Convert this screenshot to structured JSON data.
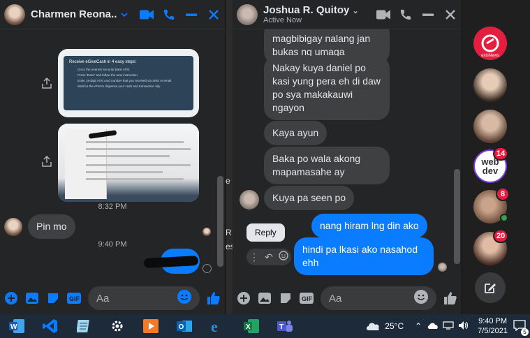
{
  "left_chat": {
    "name": "Charmen Reona...",
    "time_1": "8:32 PM",
    "msg_pin": "Pin mo",
    "time_2": "9:40 PM",
    "composer_placeholder": "Aa",
    "card_title": "Receive eGiveCash in 4 easy steps:",
    "card_steps": [
      "Go to the nearest Security Bank ATM.",
      "Press 'Enter' and follow the next instruction.",
      "Enter 16-digit ATM card number that you received via SMS or email.",
      "Wait for the ATM to dispense your cash and transaction slip."
    ]
  },
  "mid_chat": {
    "name": "Joshua R. Quitoy",
    "status": "Active Now",
    "messages": [
      {
        "text": "magbibigay nalang jan bukas ng umaga",
        "from": "them"
      },
      {
        "text": "Nakay kuya daniel po kasi yung pera eh di daw po sya makakauwi ngayon",
        "from": "them"
      },
      {
        "text": "Kaya ayun",
        "from": "them"
      },
      {
        "text": "Baka po wala akong mapamasahe ay",
        "from": "them"
      },
      {
        "text": "Kuya pa seen po",
        "from": "them"
      },
      {
        "text": "nang hiram lng din ako",
        "from": "me"
      },
      {
        "text": "hindi pa lkasi ako nasahod ehh",
        "from": "me"
      }
    ],
    "reply_label": "Reply",
    "composer_placeholder": "Aa"
  },
  "edge_letters": [
    "e",
    "R",
    "es"
  ],
  "dock": {
    "badges": [
      "14",
      "8",
      "20"
    ],
    "webdev_label_1": "web",
    "webdev_label_2": "dev",
    "news_label": "exisNews"
  },
  "taskbar": {
    "temperature": "25°C",
    "time": "9:40 PM",
    "date": "7/5/2021",
    "notification_count": "5"
  },
  "colors": {
    "accent": "#0a7cff",
    "bubble_them": "#3e4042",
    "bg": "#242526",
    "badge": "#e41e3f"
  }
}
